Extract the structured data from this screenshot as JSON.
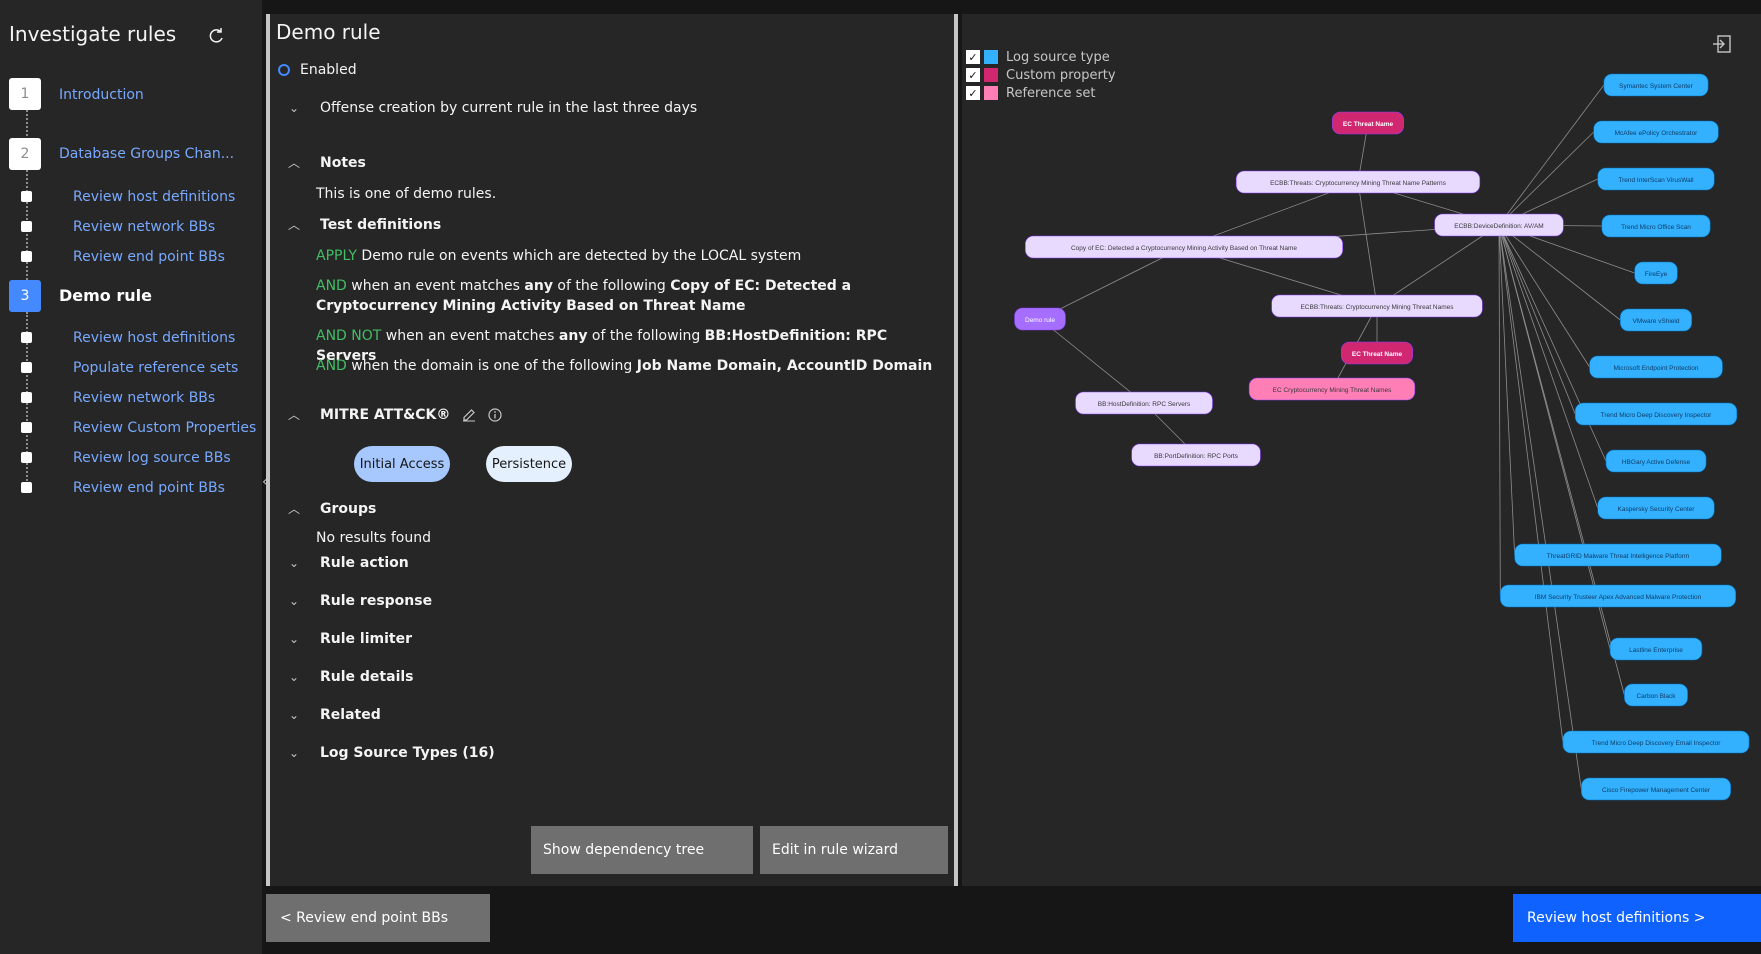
{
  "sidebar": {
    "title": "Investigate rules",
    "steps": [
      {
        "num": "1",
        "label": "Introduction"
      },
      {
        "num": "2",
        "label": "Database Groups Chan..."
      },
      {
        "num": "3",
        "label": "Demo rule"
      }
    ],
    "substeps_2": [
      "Review host definitions",
      "Review network BBs",
      "Review end point BBs"
    ],
    "substeps_3": [
      "Review host definitions",
      "Populate reference sets",
      "Review network BBs",
      "Review Custom Properties",
      "Review log source BBs",
      "Review end point BBs"
    ]
  },
  "rule": {
    "title": "Demo rule",
    "status": "Enabled",
    "offense_label": "Offense creation by current rule in the last three days",
    "notes_label": "Notes",
    "notes_text": "This is one of demo rules.",
    "tests_label": "Test definitions",
    "test_lines": [
      {
        "kw": "APPLY",
        "text": "Demo rule on events which are detected by the LOCAL system"
      },
      {
        "kw": "AND",
        "pre": "when an event matches ",
        "mid": "any",
        "post": " of the following ",
        "target": "Copy of EC: Detected a Cryptocurrency Mining Activity Based on Threat Name"
      },
      {
        "kw": "AND NOT",
        "pre": "when an event matches ",
        "mid": "any",
        "post": " of the following ",
        "target": "BB:HostDefinition: RPC Servers"
      },
      {
        "kw": "AND",
        "pre": "when the domain is one of the following ",
        "target": "Job Name Domain, AccountID Domain"
      }
    ],
    "mitre_label": "MITRE ATT&CK®",
    "tactics": [
      "Initial Access",
      "Persistence"
    ],
    "groups_label": "Groups",
    "groups_empty": "No results found",
    "sections": [
      "Rule action",
      "Rule response",
      "Rule limiter",
      "Rule details",
      "Related",
      "Log Source Types (16)"
    ],
    "btn_dependency": "Show dependency tree",
    "btn_edit": "Edit in rule wizard"
  },
  "graph": {
    "legend": [
      {
        "label": "Log source type",
        "color": "#33b1ff"
      },
      {
        "label": "Custom property",
        "color": "#d12771"
      },
      {
        "label": "Reference set",
        "color": "#ff7eb6"
      }
    ],
    "nodes": {
      "demo": "Demo rule",
      "copy_ec": "Copy of EC: Detected a Cryptocurrency Mining Activity Based on Threat Name",
      "ecbb_patterns": "ECBB:Threats: Cryptocurrency Mining Threat Name Patterns",
      "ecbb_names": "ECBB:Threats: Cryptocurrency Mining Threat Names",
      "ecbb_device": "ECBB:DeviceDefinition: AV/AM",
      "ec_threat_1": "EC Threat Name",
      "ec_threat_2": "EC Threat Name",
      "ec_crypto": "EC Cryptocurrency Mining Threat Names",
      "bb_host": "BB:HostDefinition: RPC Servers",
      "bb_port": "BB:PortDefinition: RPC Ports"
    },
    "log_sources": [
      "Symantec System Center",
      "McAfee ePolicy Orchestrator",
      "Trend InterScan VirusWall",
      "Trend Micro Office Scan",
      "FireEye",
      "VMware vShield",
      "Microsoft Endpoint Protection",
      "Trend Micro Deep Discovery Inspector",
      "HBGary Active Defense",
      "Kaspersky Security Center",
      "ThreatGRID Malware Threat Intelligence Platform",
      "IBM Security Trusteer Apex Advanced Malware Protection",
      "Lastline Enterprise",
      "Carbon Black",
      "Trend Micro Deep Discovery Email Inspector",
      "Cisco Firepower Management Center"
    ]
  },
  "nav": {
    "back": "< Review end point BBs",
    "next": "Review host definitions >"
  }
}
